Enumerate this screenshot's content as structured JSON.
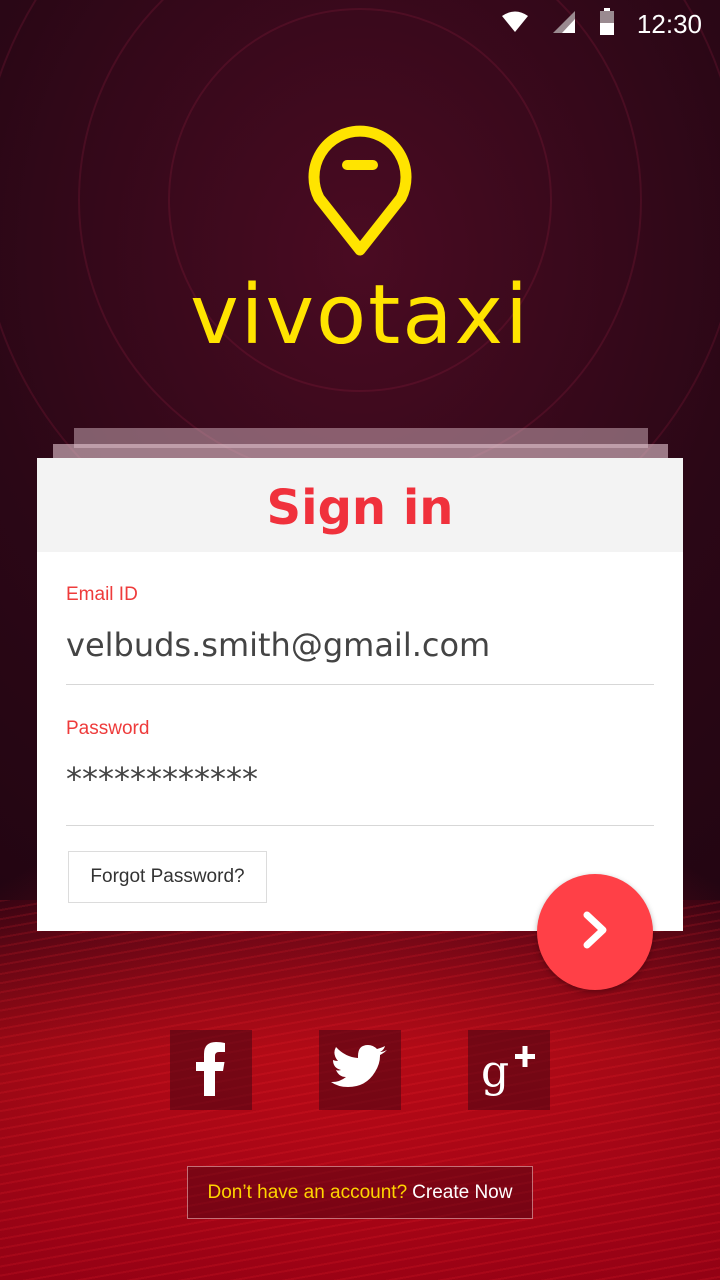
{
  "status": {
    "time": "12:30"
  },
  "brand": {
    "name": "vivotaxi",
    "logo_icon": "map-pin-icon",
    "accent": "#ffe400"
  },
  "card": {
    "title": "Sign in",
    "email": {
      "label": "Email ID",
      "value": "velbuds.smith@gmail.com"
    },
    "password": {
      "label": "Password",
      "value": "************"
    },
    "forgot_label": "Forgot Password?"
  },
  "social": [
    {
      "icon": "facebook-icon",
      "glyph": "f"
    },
    {
      "icon": "twitter-icon",
      "glyph": ""
    },
    {
      "icon": "google-plus-icon",
      "glyph": "g+"
    }
  ],
  "signup": {
    "question": "Don’t have an account?",
    "action": "Create Now"
  },
  "colors": {
    "primary_red": "#f0313c",
    "button_red": "#ff4047",
    "bg_dark": "#2a0716"
  }
}
